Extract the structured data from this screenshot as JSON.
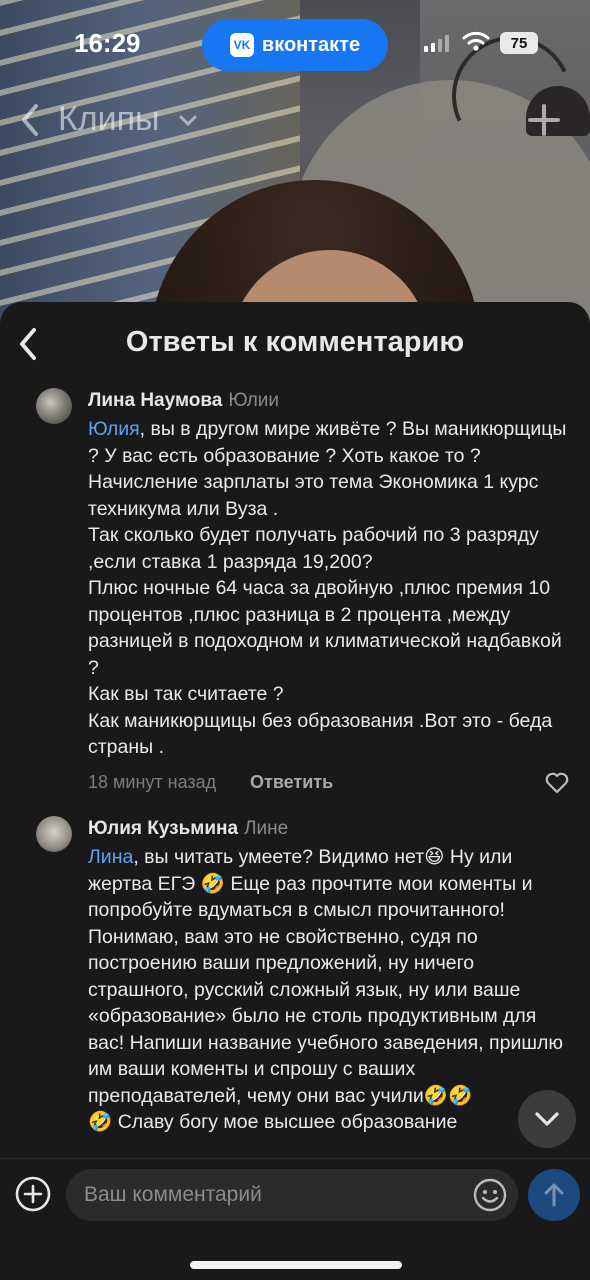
{
  "status_bar": {
    "time": "16:29",
    "app_pill": "вконтакте",
    "app_logo": "VK",
    "battery": "75"
  },
  "clips_header": {
    "title": "Клипы"
  },
  "sheet": {
    "title": "Ответы к комментарию"
  },
  "comments": [
    {
      "author": "Лина Наумова",
      "reply_to": "Юлии",
      "mention": "Юлия",
      "text": ", вы в другом мире живёте ? Вы маникюрщицы ? У вас есть образование ? Хоть какое то ? Начисление зарплаты это тема Экономика 1 курс техникума или Вуза .\nТак сколько будет получать рабочий по 3 разряду ,если ставка 1 разряда 19,200?\nПлюс ночные 64 часа за двойную ,плюс премия 10 процентов ,плюс разница в 2 процента ,между разницей в подоходном и климатической надбавкой ?\nКак вы так считаете ?\nКак маникюрщицы без образования .Вот это - беда  страны .",
      "time": "18 минут назад",
      "reply_label": "Ответить"
    },
    {
      "author": "Юлия Кузьмина",
      "reply_to": "Лине",
      "mention": "Лина",
      "text": ", вы читать умеете? Видимо нет😆 Ну или жертва ЕГЭ 🤣 Еще раз прочтите мои коменты и попробуйте вдуматься в смысл прочитанного! Понимаю, вам это не свойственно, судя по построению ваши предложений, ну ничего страшного, русский сложный язык, ну или ваше «образование» было не столь продуктивным для вас! Напиши название учебного заведения, пришлю им ваши коменты и спрошу с ваших преподавателей, чему они вас учили🤣🤣\n🤣 Славу богу мое высшее образование"
    }
  ],
  "composer": {
    "placeholder": "Ваш комментарий"
  },
  "icons": {
    "heart": "heart-icon",
    "scroll_down": "chevron-down-icon",
    "attach": "plus-circle-icon",
    "emoji": "smiley-icon",
    "send": "arrow-up-icon"
  },
  "colors": {
    "accent": "#1776f1",
    "mention": "#5ea3f3",
    "sheet_bg": "#191919",
    "send_bg": "#1d4a7e"
  }
}
